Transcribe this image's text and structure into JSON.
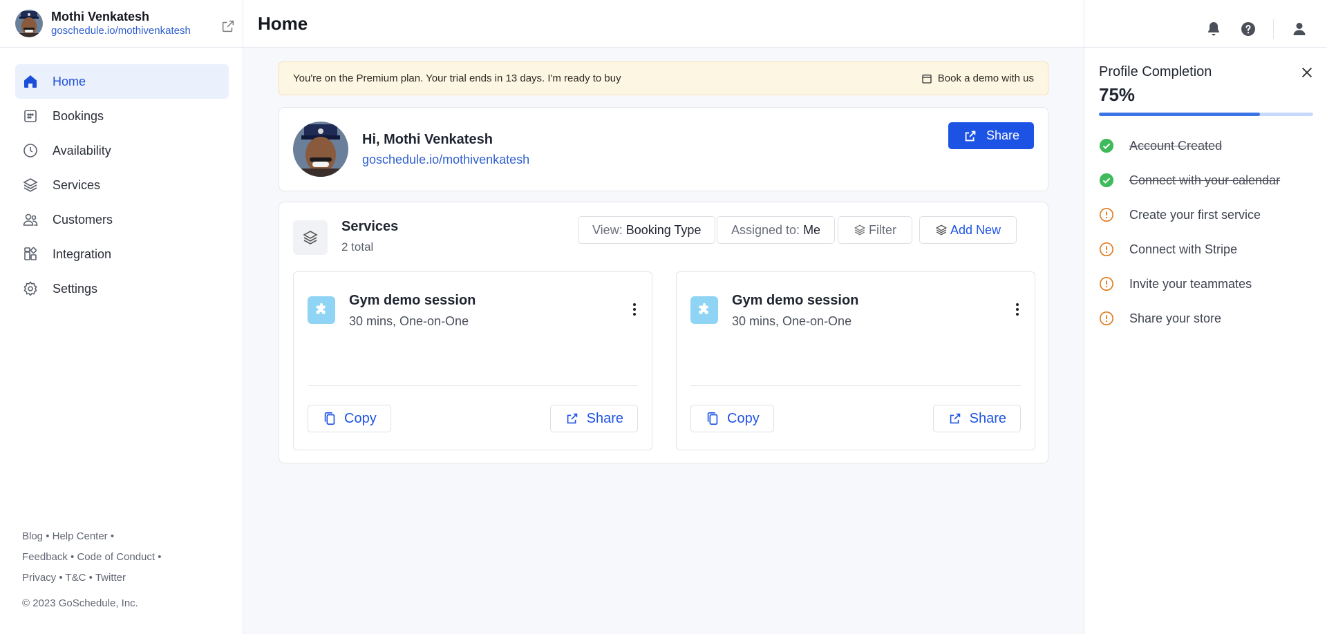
{
  "sidebar": {
    "user_name": "Mothi Venkatesh",
    "user_link": "goschedule.io/mothivenkatesh",
    "nav": [
      {
        "label": "Home",
        "icon": "home-icon",
        "active": true
      },
      {
        "label": "Bookings",
        "icon": "calendar-icon",
        "active": false
      },
      {
        "label": "Availability",
        "icon": "clock-icon",
        "active": false
      },
      {
        "label": "Services",
        "icon": "layers-icon",
        "active": false
      },
      {
        "label": "Customers",
        "icon": "users-icon",
        "active": false
      },
      {
        "label": "Integration",
        "icon": "integration-icon",
        "active": false
      },
      {
        "label": "Settings",
        "icon": "gear-icon",
        "active": false
      }
    ],
    "footer": {
      "blog": "Blog",
      "help": "Help Center",
      "feedback": "Feedback",
      "conduct": "Code of Conduct",
      "privacy": "Privacy",
      "tc": "T&C",
      "twitter": "Twitter",
      "copyright": "© 2023 GoSchedule, Inc."
    }
  },
  "header": {
    "title": "Home"
  },
  "banner": {
    "text": "You're on the Premium plan. Your trial ends in 13 days. I'm ready to buy",
    "demo_label": "Book a demo with us"
  },
  "greeting": {
    "text": "Hi, Mothi Venkatesh",
    "link": "goschedule.io/mothivenkatesh",
    "share_label": "Share"
  },
  "services": {
    "title": "Services",
    "count": "2 total",
    "view_prefix": "View:",
    "view_value": "Booking Type",
    "assigned_prefix": "Assigned to:",
    "assigned_value": "Me",
    "filter_label": "Filter",
    "add_label": "Add New",
    "items": [
      {
        "name": "Gym demo session",
        "detail": "30 mins, One-on-One",
        "copy_label": "Copy",
        "share_label": "Share"
      },
      {
        "name": "Gym demo session",
        "detail": "30 mins, One-on-One",
        "copy_label": "Copy",
        "share_label": "Share"
      }
    ]
  },
  "profile": {
    "title": "Profile Completion",
    "percent_label": "75%",
    "progress": 0.75,
    "steps": [
      {
        "label": "Account Created",
        "done": true
      },
      {
        "label": "Connect with your calendar",
        "done": true
      },
      {
        "label": "Create your first service",
        "done": false
      },
      {
        "label": "Connect with Stripe",
        "done": false
      },
      {
        "label": "Invite your teammates",
        "done": false
      },
      {
        "label": "Share your store",
        "done": false
      }
    ]
  },
  "colors": {
    "primary": "#1d53e5",
    "link": "#2f5fd0",
    "success": "#3fba5b",
    "warning": "#e07b1f",
    "banner_bg": "#fdf6e3"
  }
}
